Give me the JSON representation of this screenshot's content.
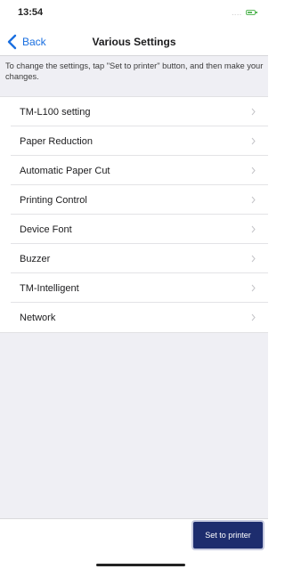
{
  "status_bar": {
    "time": "13:54",
    "signal_text": "....",
    "battery_icon": "battery-icon"
  },
  "nav": {
    "back_label": "Back",
    "title": "Various Settings"
  },
  "instruction": "To change the settings, tap \"Set to printer\" button, and then make your changes.",
  "settings_items": [
    {
      "label": "TM-L100 setting"
    },
    {
      "label": "Paper Reduction"
    },
    {
      "label": "Automatic Paper Cut"
    },
    {
      "label": "Printing Control"
    },
    {
      "label": "Device Font"
    },
    {
      "label": "Buzzer"
    },
    {
      "label": "TM-Intelligent"
    },
    {
      "label": "Network"
    }
  ],
  "footer": {
    "set_to_printer_label": "Set to printer"
  },
  "colors": {
    "accent": "#1a6fe0",
    "primary_button": "#1d2d6e",
    "background": "#efeff4"
  }
}
